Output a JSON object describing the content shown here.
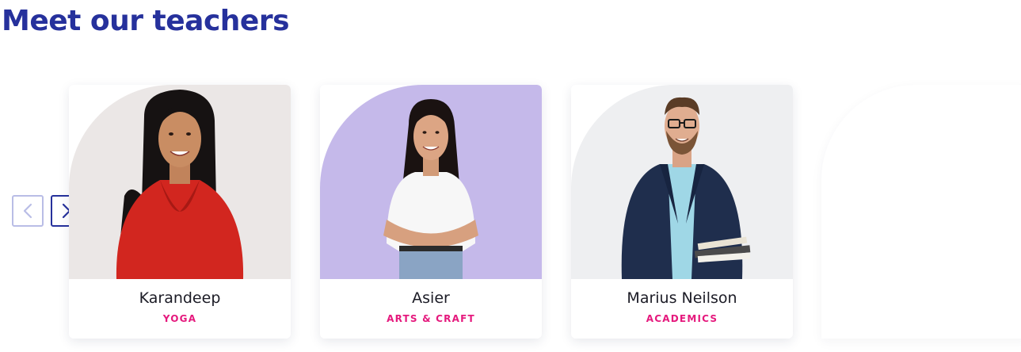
{
  "section": {
    "title": "Meet our teachers"
  },
  "carousel": {
    "prev_icon": "chevron-left-icon",
    "next_icon": "chevron-right-icon",
    "prev_border_color": "#b9bde6",
    "next_border_color": "#26319c"
  },
  "teachers": [
    {
      "name": "Karandeep",
      "subject": "YOGA",
      "photo_bg": "#ebe7e6"
    },
    {
      "name": "Asier",
      "subject": "ARTS & CRAFT",
      "photo_bg": "#c5b9ea"
    },
    {
      "name": "Marius Neilson",
      "subject": "ACADEMICS",
      "photo_bg": "#eeeff1"
    }
  ],
  "colors": {
    "title": "#26319c",
    "subject": "#e5197d",
    "name": "#1b1b25"
  }
}
